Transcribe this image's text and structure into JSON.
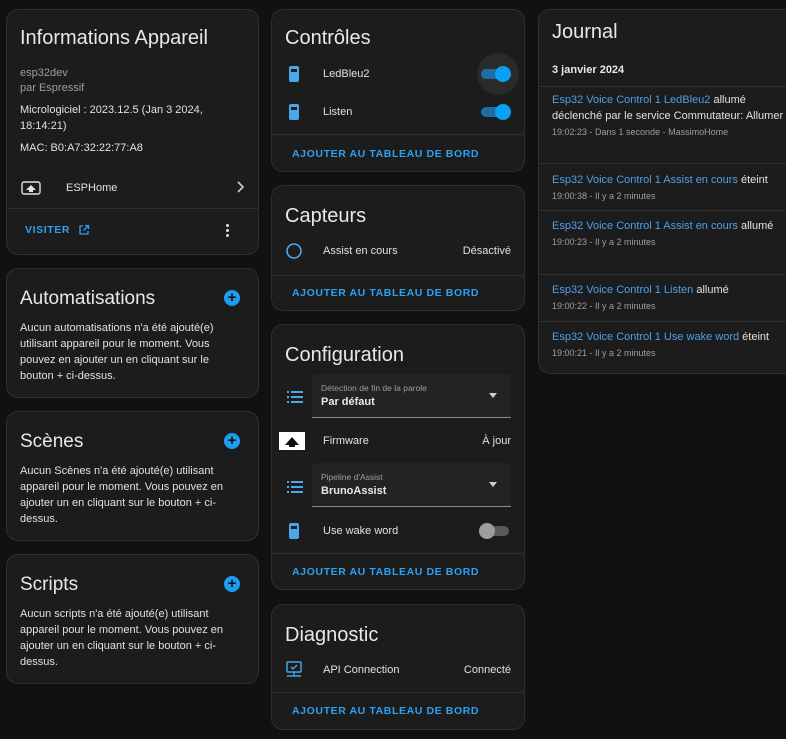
{
  "device": {
    "title": "Informations Appareil",
    "name": "esp32dev",
    "by": "par Espressif",
    "firmware": "Micrologiciel : 2023.12.5 (Jan 3 2024, 18:14:21)",
    "mac": "MAC: B0:A7:32:22:77:A8",
    "integration": "ESPHome",
    "visit": "VISITER"
  },
  "automations": {
    "title": "Automatisations",
    "text": "Aucun automatisations n'a été ajouté(e) utilisant appareil pour le moment. Vous pouvez en ajouter un en cliquant sur le bouton + ci-dessus."
  },
  "scenes": {
    "title": "Scènes",
    "text": "Aucun Scènes n'a été ajouté(e) utilisant appareil pour le moment. Vous pouvez en ajouter un en cliquant sur le bouton + ci-dessus."
  },
  "scripts": {
    "title": "Scripts",
    "text": "Aucun scripts n'a été ajouté(e) utilisant appareil pour le moment. Vous pouvez en ajouter un en cliquant sur le bouton + ci-dessus."
  },
  "controls": {
    "title": "Contrôles",
    "items": [
      {
        "label": "LedBleu2",
        "state": "on"
      },
      {
        "label": "Listen",
        "state": "on"
      }
    ],
    "action": "AJOUTER AU TABLEAU DE BORD"
  },
  "sensors": {
    "title": "Capteurs",
    "items": [
      {
        "label": "Assist en cours",
        "value": "Désactivé"
      }
    ],
    "action": "AJOUTER AU TABLEAU DE BORD"
  },
  "configuration": {
    "title": "Configuration",
    "select1": {
      "label": "Détection de fin de la parole",
      "value": "Par défaut"
    },
    "firmware": {
      "label": "Firmware",
      "value": "À jour"
    },
    "select2": {
      "label": "Pipeline d'Assist",
      "value": "BrunoAssist"
    },
    "wake": {
      "label": "Use wake word",
      "state": "off"
    },
    "action": "AJOUTER AU TABLEAU DE BORD"
  },
  "diagnostic": {
    "title": "Diagnostic",
    "items": [
      {
        "label": "API Connection",
        "value": "Connecté"
      }
    ],
    "action": "AJOUTER AU TABLEAU DE BORD"
  },
  "journal": {
    "title": "Journal",
    "date": "3 janvier 2024",
    "entries": [
      {
        "link": "Esp32 Voice Control 1 LedBleu2",
        "rest": " allumé déclenché par le service Commutateur: Allumer",
        "meta": "19:02:23 - Dans 1 seconde - MassimoHome"
      },
      {
        "link": "Esp32 Voice Control 1 Assist en cours",
        "rest": " éteint",
        "meta": "19:00:38 - Il y a 2 minutes"
      },
      {
        "link": "Esp32 Voice Control 1 Assist en cours",
        "rest": " allumé",
        "meta": "19:00:23 - Il y a 2 minutes"
      },
      {
        "link": "Esp32 Voice Control 1 Listen",
        "rest": " allumé",
        "meta": "19:00:22 - Il y a 2 minutes"
      },
      {
        "link": "Esp32 Voice Control 1 Use wake word",
        "rest": " éteint",
        "meta": "19:00:21 - Il y a 2 minutes"
      }
    ]
  },
  "icons": {
    "phone": "cellphone-icon",
    "circle": "circle-outline-icon",
    "list": "format-list-icon",
    "firmware": "chip-icon",
    "api": "monitor-network-icon",
    "external": "open-in-new-icon",
    "menu": "dots-vertical-icon",
    "chevron": "chevron-right-icon",
    "plus": "plus-circle-icon"
  },
  "colors": {
    "accent": "#2f9ff0",
    "link": "#4ea0e8",
    "card": "#1c1c1c",
    "bg": "#111111"
  }
}
